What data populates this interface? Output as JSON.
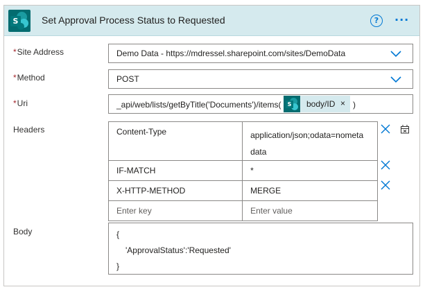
{
  "action": {
    "title": "Set Approval Process Status to Requested",
    "help_icon": "?",
    "more_icon": "···"
  },
  "fields": {
    "site_address": {
      "label": "Site Address",
      "required": true,
      "value": "Demo Data - https://mdressel.sharepoint.com/sites/DemoData"
    },
    "method": {
      "label": "Method",
      "required": true,
      "value": "POST"
    },
    "uri": {
      "label": "Uri",
      "required": true,
      "prefix": "_api/web/lists/getByTitle('Documents')/items(",
      "token": {
        "label": "body/ID",
        "close": "×"
      },
      "suffix": ")"
    },
    "headers": {
      "label": "Headers",
      "rows": [
        {
          "key": "Content-Type",
          "value": "application/json;odata=nometa data"
        },
        {
          "key": "IF-MATCH",
          "value": "*"
        },
        {
          "key": "X-HTTP-METHOD",
          "value": "MERGE"
        }
      ],
      "key_placeholder": "Enter key",
      "value_placeholder": "Enter value"
    },
    "body": {
      "label": "Body",
      "lines": [
        "{",
        "'ApprovalStatus':'Requested'",
        "}"
      ]
    }
  },
  "required_marker": "*",
  "icons": {
    "sharepoint": "sharepoint-icon",
    "chevron": "chevron-down-icon",
    "remove": "close-icon",
    "clear": "clear-table-icon"
  },
  "colors": {
    "header_bg": "#d5eaee",
    "accent": "#0078d4",
    "sharepoint_teal": "#036c70",
    "required": "#a4262c"
  }
}
